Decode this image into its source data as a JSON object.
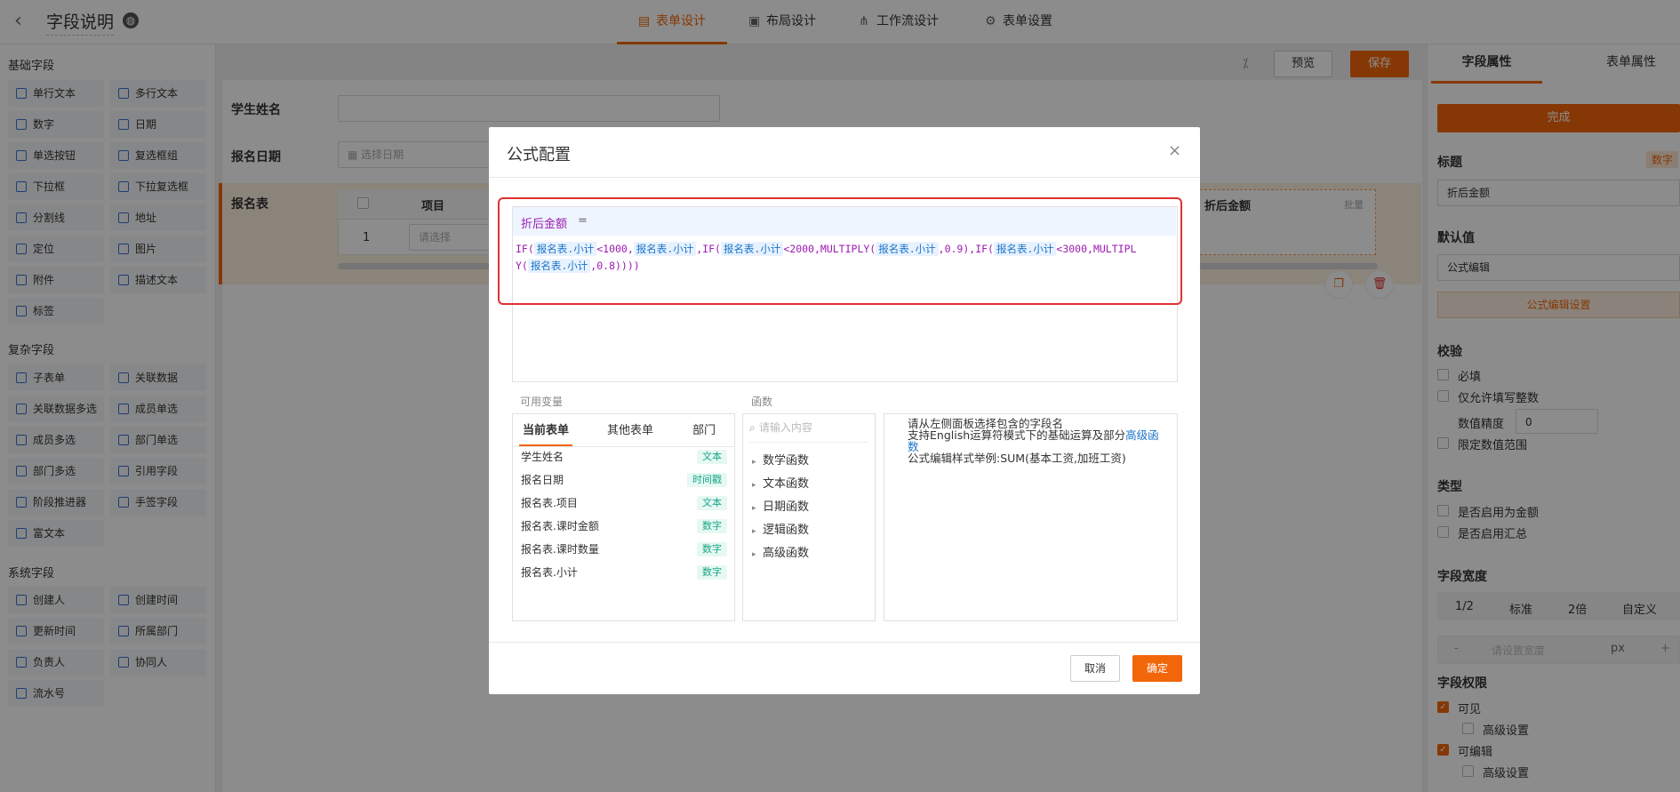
{
  "header": {
    "title": "字段说明",
    "tabs": [
      {
        "label": "表单设计",
        "active": true
      },
      {
        "label": "布局设计",
        "active": false
      },
      {
        "label": "工作流设计",
        "active": false
      },
      {
        "label": "表单设置",
        "active": false
      }
    ]
  },
  "palette": {
    "basic_title": "基础字段",
    "basic": [
      "单行文本",
      "多行文本",
      "数字",
      "日期",
      "单选按钮",
      "复选框组",
      "下拉框",
      "下拉复选框",
      "分割线",
      "地址",
      "定位",
      "图片",
      "附件",
      "描述文本",
      "标签"
    ],
    "complex_title": "复杂字段",
    "complex": [
      "子表单",
      "关联数据",
      "关联数据多选",
      "成员单选",
      "成员多选",
      "部门单选",
      "部门多选",
      "引用字段",
      "阶段推进器",
      "手签字段",
      "富文本"
    ],
    "system_title": "系统字段",
    "system": [
      "创建人",
      "创建时间",
      "更新时间",
      "所属部门",
      "负责人",
      "协同人",
      "流水号"
    ]
  },
  "toolbar": {
    "preview": "预览",
    "save": "保存"
  },
  "form": {
    "student_name_label": "学生姓名",
    "signup_date_label": "报名日期",
    "date_placeholder": "选择日期",
    "table_label": "报名表",
    "col_item": "项目",
    "col_discount": "折后金额",
    "batch": "批量",
    "row_index": "1",
    "select_placeholder": "请选择"
  },
  "right_panel": {
    "tabs": [
      "字段属性",
      "表单属性"
    ],
    "done": "完成",
    "title_label": "标题",
    "title_type": "数字",
    "title_value": "折后金额",
    "default_label": "默认值",
    "default_value": "公式编辑",
    "formula_settings": "公式编辑设置",
    "validate_label": "校验",
    "required": "必填",
    "integer_only": "仅允许填写整数",
    "precision_label": "数值精度",
    "precision_value": "0",
    "range": "限定数值范围",
    "type_label": "类型",
    "as_amount": "是否启用为金额",
    "as_sum": "是否启用汇总",
    "width_label": "字段宽度",
    "width_options": [
      "1/2",
      "标准",
      "2倍",
      "自定义"
    ],
    "width_minus": "-",
    "width_placeholder": "请设置宽度",
    "width_unit": "px",
    "width_plus": "+",
    "perm_label": "字段权限",
    "visible": "可见",
    "advanced1": "高级设置",
    "editable": "可编辑",
    "advanced2": "高级设置"
  },
  "modal": {
    "title": "公式配置",
    "close": "×",
    "field_name": "折后金额",
    "equals": "=",
    "vars_label": "可用变量",
    "funcs_label": "函数",
    "var_tabs": [
      "当前表单",
      "其他表单",
      "部门"
    ],
    "variables": [
      {
        "name": "学生姓名",
        "type": "文本"
      },
      {
        "name": "报名日期",
        "type": "时间戳"
      },
      {
        "name": "报名表.项目",
        "type": "文本"
      },
      {
        "name": "报名表.课时金额",
        "type": "数字"
      },
      {
        "name": "报名表.课时数量",
        "type": "数字"
      },
      {
        "name": "报名表.小计",
        "type": "数字"
      }
    ],
    "search_placeholder": "请输入内容",
    "functions": [
      "数学函数",
      "文本函数",
      "日期函数",
      "逻辑函数",
      "高级函数"
    ],
    "help_line1": "请从左侧面板选择包含的字段名",
    "help_line2_pre": "支持English运算符模式下的基础运算及部分",
    "help_link_a": "高级函",
    "help_link_b": "数",
    "help_line3": "公式编辑样式举例:SUM(基本工资,加班工资)",
    "cancel": "取消",
    "ok": "确定",
    "formula": {
      "var": "报名表.小计",
      "t_if": "IF(",
      "t_lt1000": "<1000,",
      "t_comma": ",",
      "t_lt2000": "<2000,MULTIPLY(",
      "t_09": ",0.9),IF(",
      "t_lt3000": "<3000,MULTIPL",
      "t_y": "Y(",
      "t_end": ",0.8))))"
    }
  }
}
